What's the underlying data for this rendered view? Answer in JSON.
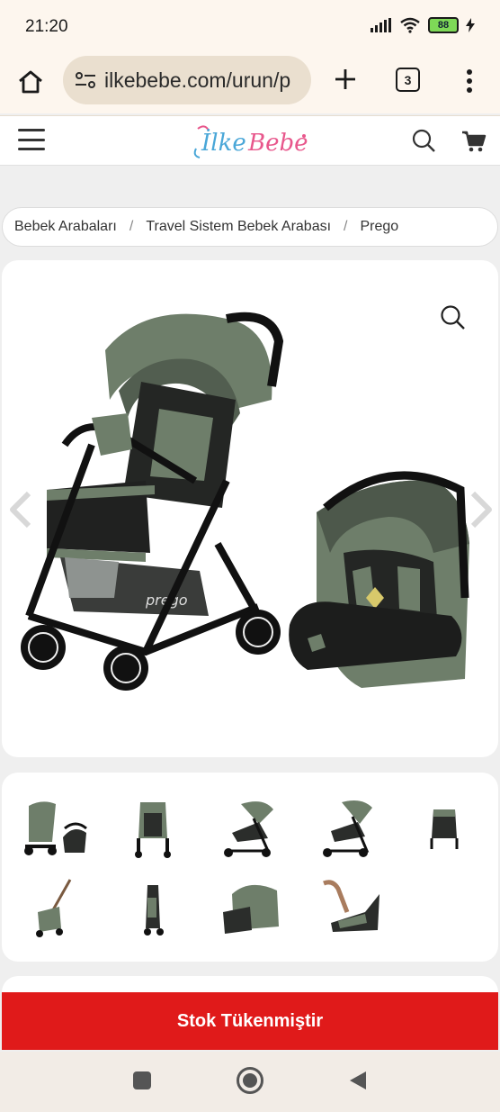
{
  "status": {
    "time": "21:20",
    "battery": "88"
  },
  "browser": {
    "url": "ilkebebe.com/urun/p",
    "tab_count": "3"
  },
  "site": {
    "logo_text": "İlkeBebe"
  },
  "breadcrumb": {
    "items": [
      "Bebek Arabaları",
      "Travel Sistem Bebek Arabası",
      "Prego"
    ],
    "separator": "/"
  },
  "product": {
    "stroller_brand": "prego"
  },
  "cta": {
    "label": "Stok Tükenmiştir"
  },
  "colors": {
    "accent": "#e01a1a",
    "stroller_green": "#6e7e6a",
    "logo_pink": "#e8578c",
    "logo_blue": "#4aa7d8"
  }
}
